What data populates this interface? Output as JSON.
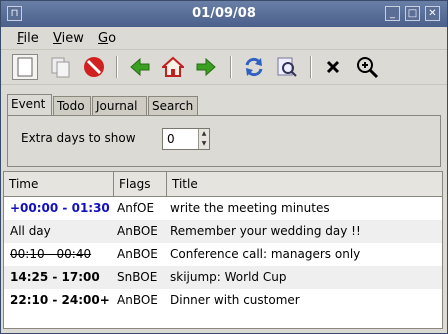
{
  "window": {
    "title": "01/09/08"
  },
  "menu": {
    "file": "File",
    "view": "View",
    "go": "Go"
  },
  "toolbar": {
    "icons": [
      "new-icon",
      "copy-icon",
      "stop-icon",
      "back-icon",
      "home-icon",
      "forward-icon",
      "refresh-icon",
      "find-icon",
      "close-icon",
      "zoom-icon"
    ]
  },
  "tabs": [
    "Event",
    "Todo",
    "Journal",
    "Search"
  ],
  "panel": {
    "label": "Extra days to show",
    "days_value": "0"
  },
  "list": {
    "headers": [
      "Time",
      "Flags",
      "Title"
    ],
    "rows": [
      {
        "time": "+00:00 - 01:30",
        "flags": "AnfOE",
        "title": "write the meeting minutes",
        "style": "blue"
      },
      {
        "time": "All day",
        "flags": "AnBOE",
        "title": "Remember your wedding day !!",
        "style": "normal"
      },
      {
        "time": "00:10 - 00:40",
        "flags": "AnBOE",
        "title": "Conference call: managers only",
        "style": "strike"
      },
      {
        "time": "14:25 - 17:00",
        "flags": "SnBOE",
        "title": "skijump: World Cup",
        "style": "bold"
      },
      {
        "time": "22:10 - 24:00+",
        "flags": "AnBOE",
        "title": "Dinner with customer",
        "style": "bold"
      }
    ]
  },
  "colors": {
    "titlebar": "#4a5f8a",
    "highlight_time": "#1010c0",
    "alt_row": "#efefef"
  }
}
